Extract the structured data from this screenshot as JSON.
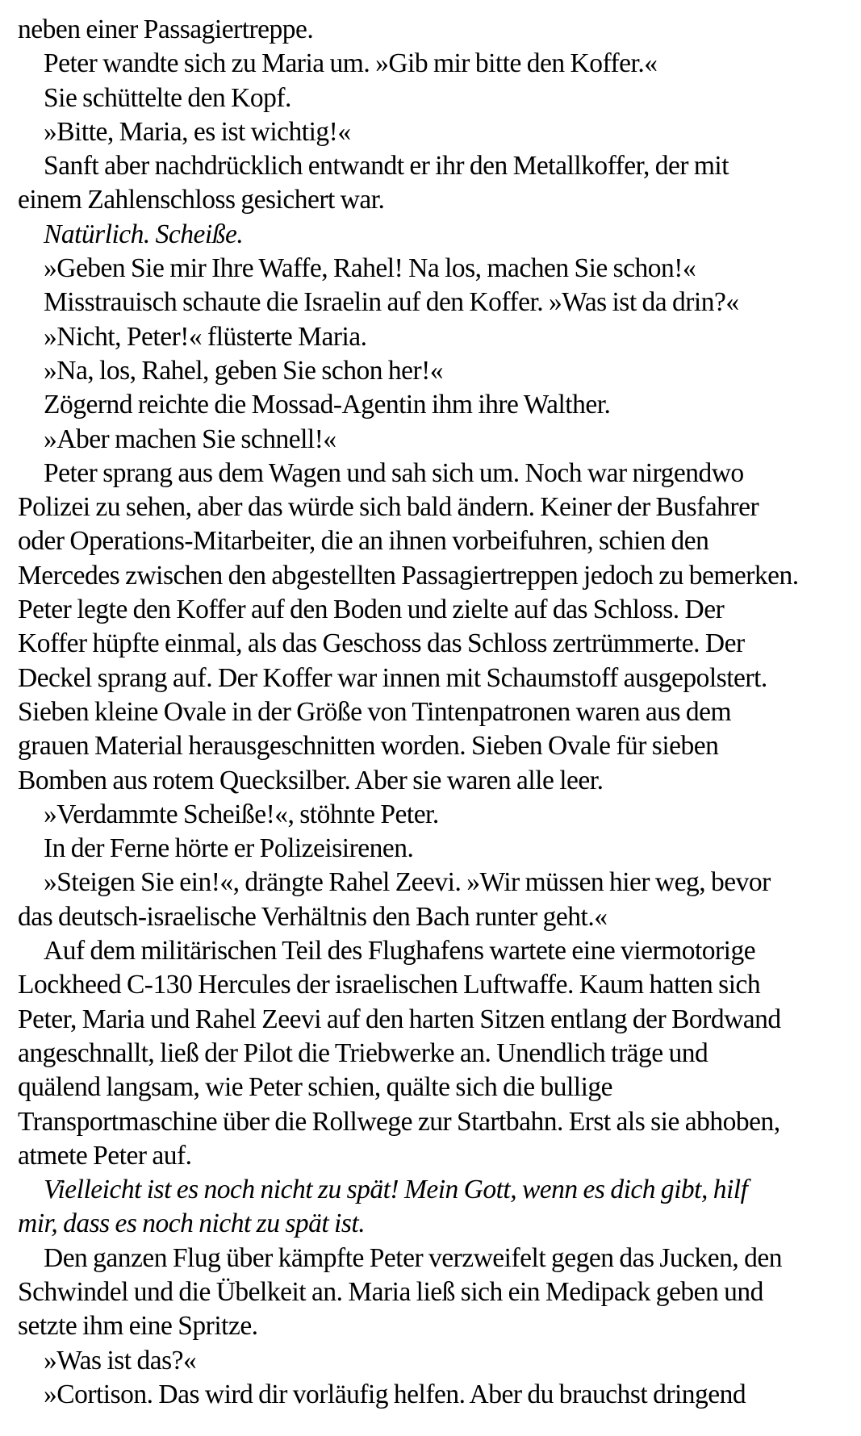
{
  "lines": [
    {
      "text": "neben einer Passagiertreppe.",
      "indent": false,
      "italic": false
    },
    {
      "text": "Peter wandte sich zu Maria um. »Gib mir bitte den Koffer.«",
      "indent": true,
      "italic": false
    },
    {
      "text": "Sie schüttelte den Kopf.",
      "indent": true,
      "italic": false
    },
    {
      "text": "»Bitte, Maria, es ist wichtig!«",
      "indent": true,
      "italic": false
    },
    {
      "text": "Sanft aber nachdrücklich entwandt er ihr den Metallkoffer, der mit",
      "indent": true,
      "italic": false
    },
    {
      "text": "einem Zahlenschloss gesichert war.",
      "indent": false,
      "italic": false
    },
    {
      "text": "Natürlich. Scheiße.",
      "indent": true,
      "italic": true
    },
    {
      "text": "»Geben Sie mir Ihre Waffe, Rahel! Na los, machen Sie schon!«",
      "indent": true,
      "italic": false
    },
    {
      "text": "Misstrauisch schaute die Israelin auf den Koffer. »Was ist da drin?«",
      "indent": true,
      "italic": false
    },
    {
      "text": "»Nicht, Peter!« flüsterte Maria.",
      "indent": true,
      "italic": false
    },
    {
      "text": "»Na, los, Rahel, geben Sie schon her!«",
      "indent": true,
      "italic": false
    },
    {
      "text": "Zögernd reichte die Mossad-Agentin ihm ihre Walther.",
      "indent": true,
      "italic": false
    },
    {
      "text": "»Aber machen Sie schnell!«",
      "indent": true,
      "italic": false
    },
    {
      "text": "Peter sprang aus dem Wagen und sah sich um. Noch war nirgendwo",
      "indent": true,
      "italic": false
    },
    {
      "text": "Polizei zu sehen, aber das würde sich bald ändern. Keiner der Busfahrer",
      "indent": false,
      "italic": false
    },
    {
      "text": "oder Operations-Mitarbeiter, die an ihnen vorbeifuhren, schien den",
      "indent": false,
      "italic": false
    },
    {
      "text": "Mercedes zwischen den abgestellten Passagiertreppen jedoch zu bemerken.",
      "indent": false,
      "italic": false
    },
    {
      "text": "Peter legte den Koffer auf den Boden und zielte auf das Schloss. Der",
      "indent": false,
      "italic": false
    },
    {
      "text": "Koffer hüpfte einmal, als das Geschoss das Schloss zertrümmerte. Der",
      "indent": false,
      "italic": false
    },
    {
      "text": "Deckel sprang auf. Der Koffer war innen mit Schaumstoff ausgepolstert.",
      "indent": false,
      "italic": false
    },
    {
      "text": "Sieben kleine Ovale in der Größe von Tintenpatronen waren aus dem",
      "indent": false,
      "italic": false
    },
    {
      "text": "grauen Material herausgeschnitten worden. Sieben Ovale für sieben",
      "indent": false,
      "italic": false
    },
    {
      "text": "Bomben aus rotem Quecksilber. Aber sie waren alle leer.",
      "indent": false,
      "italic": false
    },
    {
      "text": "»Verdammte Scheiße!«, stöhnte Peter.",
      "indent": true,
      "italic": false
    },
    {
      "text": "In der Ferne hörte er Polizeisirenen.",
      "indent": true,
      "italic": false
    },
    {
      "text": "»Steigen Sie ein!«, drängte Rahel Zeevi. »Wir müssen hier weg, bevor",
      "indent": true,
      "italic": false
    },
    {
      "text": "das deutsch-israelische Verhältnis den Bach runter geht.«",
      "indent": false,
      "italic": false
    },
    {
      "text": "Auf dem militärischen Teil des Flughafens wartete eine viermotorige",
      "indent": true,
      "italic": false
    },
    {
      "text": "Lockheed C-130 Hercules der israelischen Luftwaffe. Kaum hatten sich",
      "indent": false,
      "italic": false
    },
    {
      "text": "Peter, Maria und Rahel Zeevi auf den harten Sitzen entlang der Bordwand",
      "indent": false,
      "italic": false
    },
    {
      "text": "angeschnallt, ließ der Pilot die Triebwerke an. Unendlich träge und",
      "indent": false,
      "italic": false
    },
    {
      "text": "quälend langsam, wie Peter schien, quälte sich die bullige",
      "indent": false,
      "italic": false
    },
    {
      "text": "Transportmaschine über die Rollwege zur Startbahn. Erst als sie abhoben,",
      "indent": false,
      "italic": false
    },
    {
      "text": "atmete Peter auf.",
      "indent": false,
      "italic": false
    },
    {
      "text": "Vielleicht ist es noch nicht zu spät! Mein Gott, wenn es dich gibt, hilf",
      "indent": true,
      "italic": true
    },
    {
      "text": "mir, dass es noch nicht zu spät ist.",
      "indent": false,
      "italic": true
    },
    {
      "text": "Den ganzen Flug über kämpfte Peter verzweifelt gegen das Jucken, den",
      "indent": true,
      "italic": false
    },
    {
      "text": "Schwindel und die Übelkeit an. Maria ließ sich ein Medipack geben und",
      "indent": false,
      "italic": false
    },
    {
      "text": "setzte ihm eine Spritze.",
      "indent": false,
      "italic": false
    },
    {
      "text": "»Was ist das?«",
      "indent": true,
      "italic": false
    },
    {
      "text": "»Cortison. Das wird dir vorläufig helfen. Aber du brauchst dringend",
      "indent": true,
      "italic": false
    }
  ]
}
